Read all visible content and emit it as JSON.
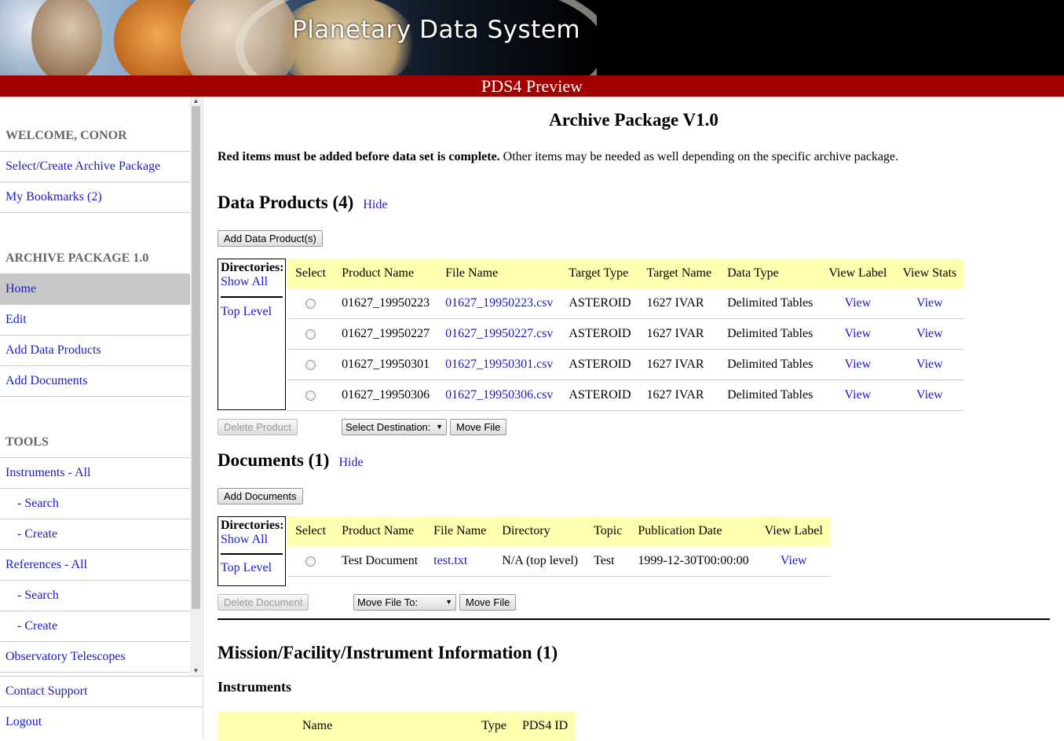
{
  "header": {
    "title": "Planetary Data System",
    "subtitle": "PDS4 Preview"
  },
  "sidebar": {
    "welcome": "WELCOME, CONOR",
    "account_items": [
      {
        "label": "Select/Create Archive Package"
      },
      {
        "label": "My Bookmarks (2)"
      }
    ],
    "package_heading": "ARCHIVE PACKAGE 1.0",
    "package_items": [
      {
        "label": "Home"
      },
      {
        "label": "Edit"
      },
      {
        "label": "Add Data Products"
      },
      {
        "label": "Add Documents"
      }
    ],
    "tools_heading": "TOOLS",
    "tools_items": [
      {
        "label": "Instruments - All"
      },
      {
        "label": "- Search"
      },
      {
        "label": "- Create"
      },
      {
        "label": "References - All"
      },
      {
        "label": "- Search"
      },
      {
        "label": "- Create"
      },
      {
        "label": "Observatory Telescopes"
      }
    ],
    "bottom_items": [
      {
        "label": "Contact Support"
      },
      {
        "label": "Logout"
      }
    ],
    "scroll_up": "▲",
    "scroll_down": "▼"
  },
  "main": {
    "page_title": "Archive Package V1.0",
    "note_bold": "Red items must be added before data set is complete.",
    "note_rest": " Other items may be needed as well depending on the specific archive package.",
    "directories": {
      "heading": "Directories:",
      "show_all": "Show All",
      "top_level": "Top Level"
    },
    "data_products": {
      "title": "Data Products (4)",
      "hide": "Hide",
      "add_button": "Add Data Product(s)",
      "columns": [
        "Select",
        "Product Name",
        "File Name",
        "Target Type",
        "Target Name",
        "Data Type",
        "View Label",
        "View Stats"
      ],
      "rows": [
        {
          "product": "01627_19950223",
          "file": "01627_19950223.csv",
          "target_type": "ASTEROID",
          "target_name": "1627 IVAR",
          "data_type": "Delimited Tables",
          "view_label": "View",
          "view_stats": "View"
        },
        {
          "product": "01627_19950227",
          "file": "01627_19950227.csv",
          "target_type": "ASTEROID",
          "target_name": "1627 IVAR",
          "data_type": "Delimited Tables",
          "view_label": "View",
          "view_stats": "View"
        },
        {
          "product": "01627_19950301",
          "file": "01627_19950301.csv",
          "target_type": "ASTEROID",
          "target_name": "1627 IVAR",
          "data_type": "Delimited Tables",
          "view_label": "View",
          "view_stats": "View"
        },
        {
          "product": "01627_19950306",
          "file": "01627_19950306.csv",
          "target_type": "ASTEROID",
          "target_name": "1627 IVAR",
          "data_type": "Delimited Tables",
          "view_label": "View",
          "view_stats": "View"
        }
      ],
      "delete_button": "Delete Product",
      "destination_select": "Select Destination:",
      "move_button": "Move File"
    },
    "documents": {
      "title": "Documents (1)",
      "hide": "Hide",
      "add_button": "Add Documents",
      "columns": [
        "Select",
        "Product Name",
        "File Name",
        "Directory",
        "Topic",
        "Publication Date",
        "View Label"
      ],
      "rows": [
        {
          "product": "Test Document",
          "file": "test.txt",
          "directory": "N/A (top level)",
          "topic": "Test",
          "date": "1999-12-30T00:00:00",
          "view_label": "View"
        }
      ],
      "delete_button": "Delete Document",
      "move_select": "Move File To:",
      "move_button": "Move File"
    },
    "mission": {
      "title": "Mission/Facility/Instrument Information (1)",
      "instruments_heading": "Instruments",
      "columns": [
        "Name",
        "Type",
        "PDS4 ID"
      ]
    }
  }
}
